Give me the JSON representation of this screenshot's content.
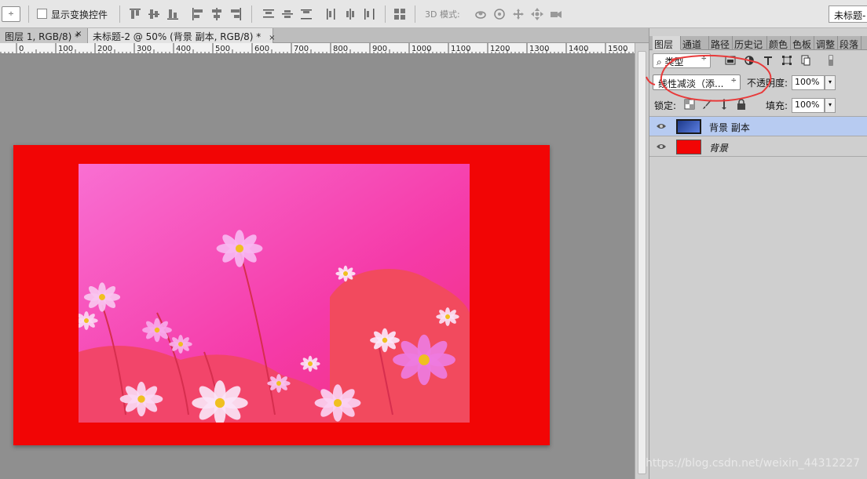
{
  "toolbar": {
    "show_transform_controls_label": "显示变换控件",
    "mode_3d_label": "3D 模式:",
    "document_selector_value": "未标题-"
  },
  "tabs": [
    {
      "label": "图层 1, RGB/8) *"
    },
    {
      "label": "未标题-2 @ 50% (背景 副本, RGB/8) *"
    }
  ],
  "close_glyph": "×",
  "ruler": {
    "ticks": [
      "0",
      "100",
      "200",
      "300",
      "400",
      "500",
      "600",
      "700",
      "800",
      "900",
      "1000",
      "1100",
      "1200",
      "1300",
      "1400",
      "1500"
    ]
  },
  "panel": {
    "tabs": [
      {
        "label": "图层",
        "active": true
      },
      {
        "label": "通道"
      },
      {
        "label": "路径"
      },
      {
        "label": "历史记"
      },
      {
        "label": "颜色"
      },
      {
        "label": "色板"
      },
      {
        "label": "调整"
      },
      {
        "label": "段落"
      }
    ],
    "filter_label": "⌕ 类型",
    "filter_arrow": "÷",
    "blend_mode": "线性减淡（添...",
    "blend_arrow": "÷",
    "opacity_label": "不透明度:",
    "opacity_value": "100%",
    "lock_label": "锁定:",
    "fill_label": "填充:",
    "fill_value": "100%",
    "dropdown_arrow": "▾",
    "layers": [
      {
        "name": "背景 副本",
        "selected": true
      },
      {
        "name": "背景",
        "selected": false
      }
    ]
  },
  "colors": {
    "document_background": "#f20505",
    "layer_selected": "#b7cbf1",
    "annotation": "#e83a3a"
  },
  "icons": [
    "left-arrow-icon",
    "align-top-icon",
    "align-vcenter-icon",
    "align-bottom-icon",
    "align-left-icon",
    "align-hcenter-icon",
    "align-right-icon",
    "distribute-icon",
    "orbit-icon",
    "roll-icon",
    "drag-icon",
    "slide-icon",
    "camera-icon",
    "eye-icon",
    "image-filter-icon",
    "adjustment-filter-icon",
    "type-filter-icon",
    "shape-filter-icon",
    "smart-filter-icon",
    "lock-icon"
  ],
  "watermark": "https://blog.csdn.net/weixin_44312227"
}
